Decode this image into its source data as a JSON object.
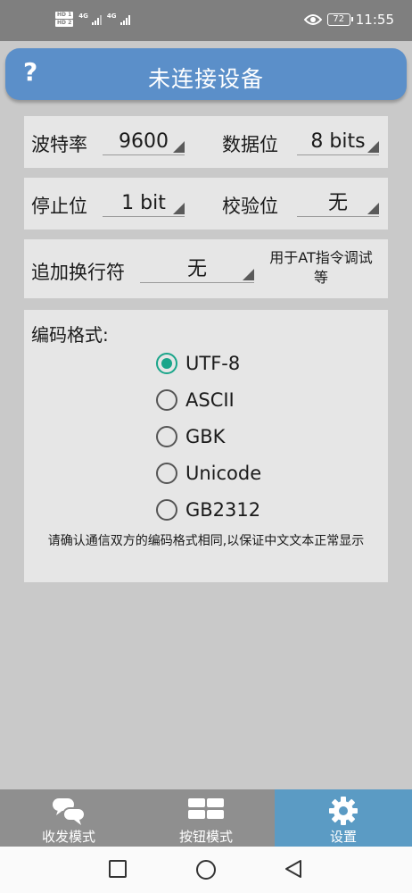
{
  "status_bar": {
    "hd1": "HD 1",
    "hd2": "HD 2",
    "net1": "4G",
    "net2": "4G",
    "battery": "72",
    "time": "11:55"
  },
  "header": {
    "help_label": "?",
    "title": "未连接设备"
  },
  "serial": {
    "baud_label": "波特率",
    "baud_value": "9600",
    "databits_label": "数据位",
    "databits_value": "8 bits",
    "stopbits_label": "停止位",
    "stopbits_value": "1 bit",
    "parity_label": "校验位",
    "parity_value": "无",
    "newline_label": "追加换行符",
    "newline_value": "无",
    "newline_note": "用于AT指令调试等"
  },
  "encoding": {
    "title": "编码格式:",
    "options": [
      {
        "label": "UTF-8",
        "selected": true
      },
      {
        "label": "ASCII",
        "selected": false
      },
      {
        "label": "GBK",
        "selected": false
      },
      {
        "label": "Unicode",
        "selected": false
      },
      {
        "label": "GB2312",
        "selected": false
      }
    ],
    "note": "请确认通信双方的编码格式相同,以保证中文文本正常显示"
  },
  "bottom_nav": [
    {
      "label": "收发模式",
      "icon": "chat-icon",
      "active": false
    },
    {
      "label": "按钮模式",
      "icon": "grid-buttons-icon",
      "active": false
    },
    {
      "label": "设置",
      "icon": "gear-icon",
      "active": true
    }
  ],
  "colors": {
    "accent": "#5b8fc9",
    "nav_active": "#5b9bc4",
    "radio_selected": "#1aa58a",
    "panel_bg": "#e6e6e6",
    "page_bg": "#c9c9c9"
  }
}
